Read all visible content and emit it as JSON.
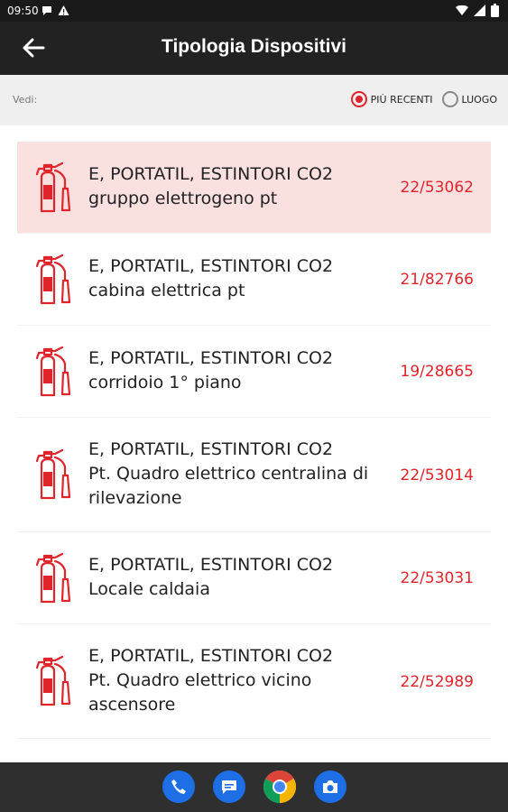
{
  "status_bar": {
    "time": "09:50"
  },
  "app_bar": {
    "title": "Tipologia Dispositivi"
  },
  "filter": {
    "label": "Vedi:",
    "options": [
      {
        "label": "PIÙ RECENTI",
        "selected": true
      },
      {
        "label": "LUOGO",
        "selected": false
      }
    ]
  },
  "colors": {
    "accent": "#e0242c",
    "selected_row": "#fbe0e0",
    "app_bar": "#222222"
  },
  "items": [
    {
      "icon": "fire-extinguisher-icon",
      "line1": "E, PORTATIL, ESTINTORI CO2",
      "line2": "gruppo elettrogeno pt",
      "line3": "",
      "code": "22/53062",
      "selected": true
    },
    {
      "icon": "fire-extinguisher-icon",
      "line1": "E, PORTATIL, ESTINTORI CO2",
      "line2": "cabina elettrica pt",
      "line3": "",
      "code": "21/82766",
      "selected": false
    },
    {
      "icon": "fire-extinguisher-icon",
      "line1": "E, PORTATIL, ESTINTORI CO2",
      "line2": "corridoio 1° piano",
      "line3": "",
      "code": "19/28665",
      "selected": false
    },
    {
      "icon": "fire-extinguisher-icon",
      "line1": "E, PORTATIL, ESTINTORI CO2",
      "line2": "Pt. Quadro elettrico centralina di",
      "line3": "rilevazione",
      "code": "22/53014",
      "selected": false
    },
    {
      "icon": "fire-extinguisher-icon",
      "line1": "E, PORTATIL, ESTINTORI CO2",
      "line2": "Locale caldaia",
      "line3": "",
      "code": "22/53031",
      "selected": false
    },
    {
      "icon": "fire-extinguisher-icon",
      "line1": "E, PORTATIL, ESTINTORI CO2",
      "line2": "Pt. Quadro elettrico vicino",
      "line3": "ascensore",
      "code": "22/52989",
      "selected": false
    }
  ],
  "dock": [
    {
      "icon": "phone-icon"
    },
    {
      "icon": "messages-icon"
    },
    {
      "icon": "chrome-icon"
    },
    {
      "icon": "camera-icon"
    }
  ]
}
